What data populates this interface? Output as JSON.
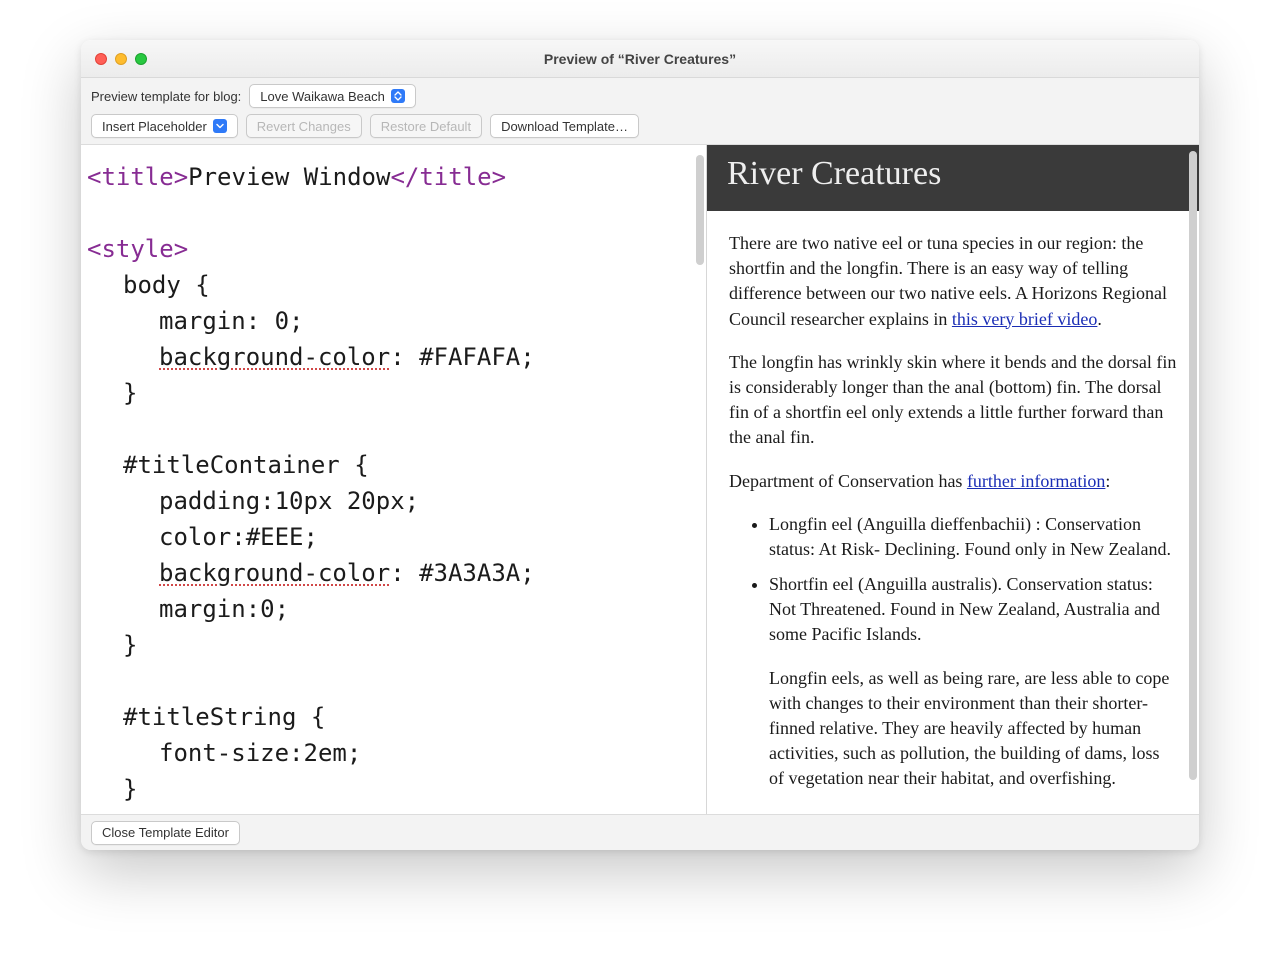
{
  "window": {
    "title": "Preview of “River Creatures”"
  },
  "toolbar": {
    "template_label": "Preview template for blog:",
    "blog_selected": "Love Waikawa Beach",
    "insert_placeholder": "Insert Placeholder",
    "revert_changes": "Revert Changes",
    "restore_default": "Restore Default",
    "download_template": "Download Template…"
  },
  "editor": {
    "lines": [
      {
        "cls": "",
        "html": "<span class='tag'>&lt;title&gt;</span><span class='plain'>Preview Window</span><span class='tag'>&lt;/title&gt;</span>"
      },
      {
        "cls": "",
        "html": ""
      },
      {
        "cls": "",
        "html": "<span class='tag'>&lt;style&gt;</span>"
      },
      {
        "cls": "ind1",
        "html": "<span class='plain'>body {</span>"
      },
      {
        "cls": "ind2",
        "html": "<span class='plain'>margin: 0;</span>"
      },
      {
        "cls": "ind2",
        "html": "<span class='plain spellerr'>background-color</span><span class='plain'>: #FAFAFA;</span>"
      },
      {
        "cls": "ind1",
        "html": "<span class='plain'>}</span>"
      },
      {
        "cls": "",
        "html": ""
      },
      {
        "cls": "ind1",
        "html": "<span class='plain'>#titleContainer {</span>"
      },
      {
        "cls": "ind2",
        "html": "<span class='plain'>padding:10px 20px;</span>"
      },
      {
        "cls": "ind2",
        "html": "<span class='plain'>color:#EEE;</span>"
      },
      {
        "cls": "ind2",
        "html": "<span class='plain spellerr'>background-color</span><span class='plain'>: #3A3A3A;</span>"
      },
      {
        "cls": "ind2",
        "html": "<span class='plain'>margin:0;</span>"
      },
      {
        "cls": "ind1",
        "html": "<span class='plain'>}</span>"
      },
      {
        "cls": "",
        "html": ""
      },
      {
        "cls": "ind1",
        "html": "<span class='plain'>#titleString {</span>"
      },
      {
        "cls": "ind2",
        "html": "<span class='plain'>font-size:2em;</span>"
      },
      {
        "cls": "ind1",
        "html": "<span class='plain'>}</span>"
      }
    ]
  },
  "preview": {
    "title": "River Creatures",
    "p1_before": "There are two native eel or tuna species in our region: the shortfin and the longfin. There is an easy way of telling difference between our two native eels. A Horizons Regional Council researcher explains in ",
    "p1_link": "this very brief video",
    "p1_after": ".",
    "p2": "The longfin has wrinkly skin where it bends and the dorsal fin is considerably longer than the anal (bottom) fin. The dorsal fin of a shortfin eel only extends a little further forward than the anal fin.",
    "p3_before": "Department of Conservation has ",
    "p3_link": "further information",
    "p3_after": ":",
    "li1": "Longfin eel (Anguilla dieffenbachii) : Conservation status: At Risk- Declining. Found only in New Zealand.",
    "li2": "Shortfin eel (Anguilla australis). Conservation status: Not Threatened. Found in New Zealand, Australia and some Pacific Islands.",
    "li2_extra": "Longfin eels, as well as being rare, are less able to cope with changes to their environment than their shorter-finned relative. They are heavily affected by human activities, such as pollution, the building of dams, loss of vegetation near their habitat, and overfishing."
  },
  "footer": {
    "close_editor": "Close Template Editor"
  }
}
